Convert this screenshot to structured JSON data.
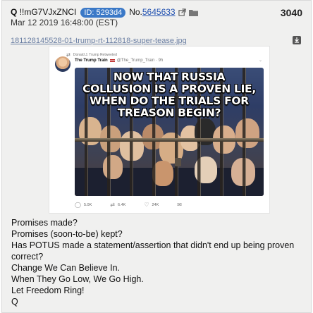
{
  "post": {
    "name": "Q",
    "tripcode": "!!mG7VJxZNCI",
    "id_label": "ID: 5293d4",
    "post_number_label": "No.",
    "post_number": "5645633",
    "post_count": "3040",
    "timestamp": "Mar 12 2019 16:48:00 (EST)",
    "filename": "181128145528-01-trump-rt-112818-super-tease.jpg"
  },
  "tweet": {
    "retweet_label": "Donald J. Trump Retweeted",
    "author_name": "The Trump Train",
    "author_handle": "@The_Trump_Train · 9h",
    "meme_caption": "NOW THAT RUSSIA COLLUSION IS A PROVEN LIE, WHEN DO THE TRIALS FOR TREASON BEGIN?",
    "replies": "5.0K",
    "retweets": "6.4K",
    "likes": "24K"
  },
  "body_lines": [
    "Promises made?",
    "Promises (soon-to-be) kept?",
    "Has POTUS made a statement/assertion that didn't end up being proven correct?",
    "Change We Can Believe In.",
    "When They Go Low, We Go High.",
    "Let Freedom Ring!",
    "Q"
  ],
  "colors": {
    "id_badge": "#3b79c7",
    "post_link": "#2050b0",
    "filename": "#6b7fa3",
    "post_bg": "#f0f0ef"
  },
  "icons": {
    "external_link": "external-link-icon",
    "folder": "folder-icon",
    "download": "download-icon",
    "retweet": "retweet-icon",
    "reply": "reply-icon",
    "like": "heart-icon"
  }
}
